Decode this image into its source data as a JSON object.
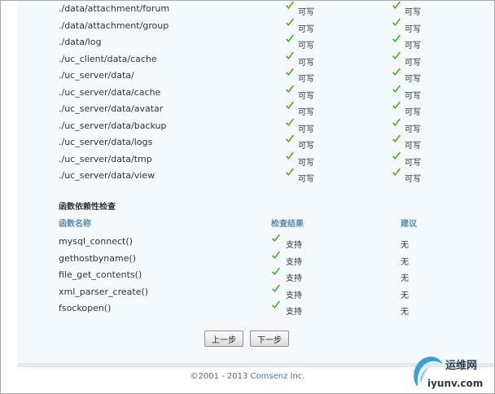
{
  "dirs": [
    {
      "path": "./data/attachment/forum",
      "status1": "可写",
      "status2": "可写"
    },
    {
      "path": "./data/attachment/group",
      "status1": "可写",
      "status2": "可写"
    },
    {
      "path": "./data/log",
      "status1": "可写",
      "status2": "可写"
    },
    {
      "path": "./uc_client/data/cache",
      "status1": "可写",
      "status2": "可写"
    },
    {
      "path": "./uc_server/data/",
      "status1": "可写",
      "status2": "可写"
    },
    {
      "path": "./uc_server/data/cache",
      "status1": "可写",
      "status2": "可写"
    },
    {
      "path": "./uc_server/data/avatar",
      "status1": "可写",
      "status2": "可写"
    },
    {
      "path": "./uc_server/data/backup",
      "status1": "可写",
      "status2": "可写"
    },
    {
      "path": "./uc_server/data/logs",
      "status1": "可写",
      "status2": "可写"
    },
    {
      "path": "./uc_server/data/tmp",
      "status1": "可写",
      "status2": "可写"
    },
    {
      "path": "./uc_server/data/view",
      "status1": "可写",
      "status2": "可写"
    }
  ],
  "func_check": {
    "title": "函数依赖性检查",
    "headers": {
      "name": "函数名称",
      "result": "检查结果",
      "suggestion": "建议"
    },
    "rows": [
      {
        "name": "mysql_connect()",
        "result": "支持",
        "suggestion": "无"
      },
      {
        "name": "gethostbyname()",
        "result": "支持",
        "suggestion": "无"
      },
      {
        "name": "file_get_contents()",
        "result": "支持",
        "suggestion": "无"
      },
      {
        "name": "xml_parser_create()",
        "result": "支持",
        "suggestion": "无"
      },
      {
        "name": "fsockopen()",
        "result": "支持",
        "suggestion": "无"
      }
    ]
  },
  "buttons": {
    "prev": "上一步",
    "next": "下一步"
  },
  "footer": {
    "copyright": "©2001 - 2013 ",
    "brand": "Comsenz",
    "suffix": " Inc."
  },
  "watermark": {
    "title": "运维网",
    "url": "iyunv.com"
  },
  "colors": {
    "check": "#4cae1c",
    "header": "#5a8bb0",
    "brand": "#3b7bbf"
  },
  "icons": {
    "status": "check-icon"
  }
}
